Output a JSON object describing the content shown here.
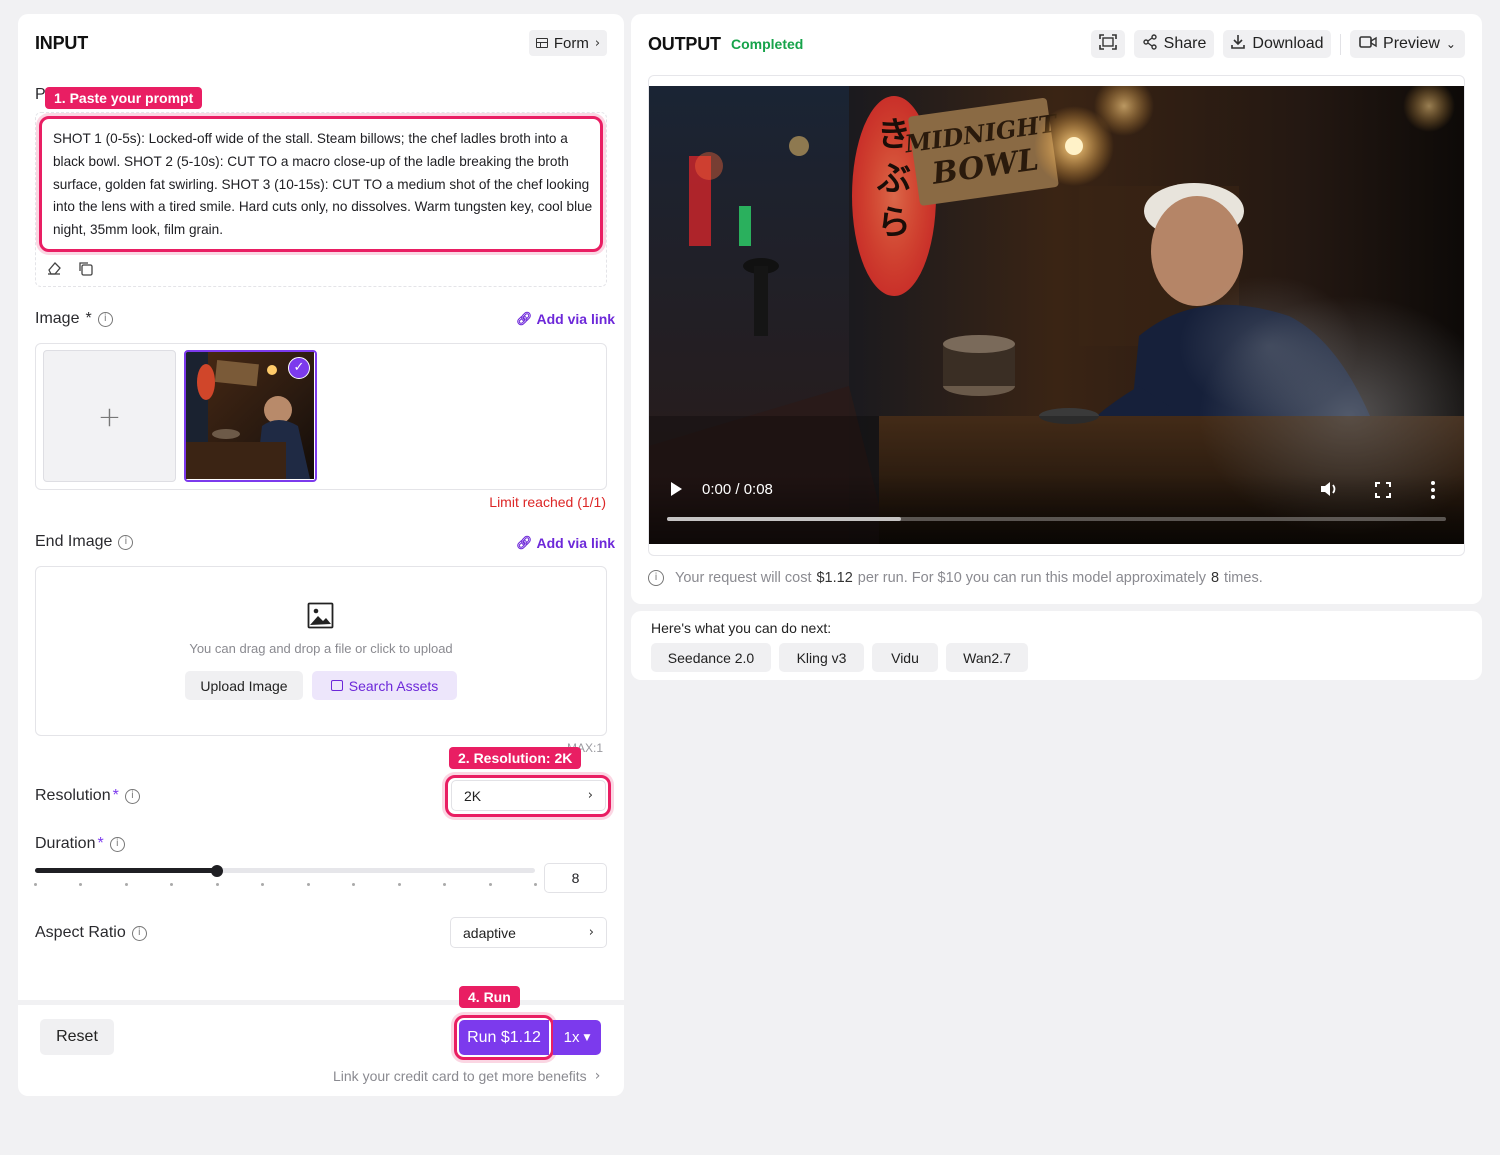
{
  "input": {
    "title": "INPUT",
    "form_label": "Form",
    "prompt": {
      "label_partial": "P",
      "callout": "1. Paste your prompt",
      "text": "SHOT 1 (0-5s): Locked-off wide of the stall. Steam billows; the chef ladles broth into a black bowl. SHOT 2 (5-10s): CUT TO a macro close-up of the ladle breaking the broth surface, golden fat swirling. SHOT 3 (10-15s): CUT TO a medium shot of the chef looking into the lens with a tired smile. Hard cuts only, no dissolves. Warm tungsten key, cool blue night, 35mm look, film grain."
    },
    "image": {
      "label": "Image",
      "required_mark": "*",
      "add_link": "Add via link",
      "limit_text": "Limit reached (1/1)",
      "thumb_sign": "MIDNIGHT BOWL"
    },
    "end_image": {
      "label": "End Image",
      "add_link": "Add via link",
      "drop_hint": "You can drag and drop a file or click to upload",
      "upload_button": "Upload Image",
      "search_button": "Search Assets",
      "max_text": "MAX:1"
    },
    "resolution": {
      "label": "Resolution",
      "required_mark": "*",
      "callout": "2. Resolution: 2K",
      "value": "2K"
    },
    "duration": {
      "label": "Duration",
      "required_mark": "*",
      "value": "8",
      "min": 4,
      "max": 15
    },
    "aspect_ratio": {
      "label": "Aspect Ratio",
      "value": "adaptive"
    },
    "footer": {
      "reset": "Reset",
      "callout": "4. Run",
      "run_label": "Run $1.12",
      "multiplier": "1x",
      "credit_link": "Link your credit card to get more benefits"
    }
  },
  "output": {
    "title": "OUTPUT",
    "status": "Completed",
    "share": "Share",
    "download": "Download",
    "preview": "Preview",
    "video": {
      "time": "0:00 / 0:08",
      "sign_text": "MIDNIGHT BOWL",
      "buffer_progress": 0.3
    },
    "cost": {
      "prefix": "Your request will cost",
      "amount": "$1.12",
      "middle": "per run. For $10 you can run this model approximately",
      "count": "8",
      "suffix": "times."
    }
  },
  "next": {
    "heading": "Here's what you can do next:",
    "items": [
      "Seedance 2.0",
      "Kling v3",
      "Vidu",
      "Wan2.7"
    ]
  },
  "colors": {
    "accent": "#7c3aed",
    "callout": "#e91e63",
    "status_green": "#16a34a",
    "limit_red": "#dc2626"
  }
}
